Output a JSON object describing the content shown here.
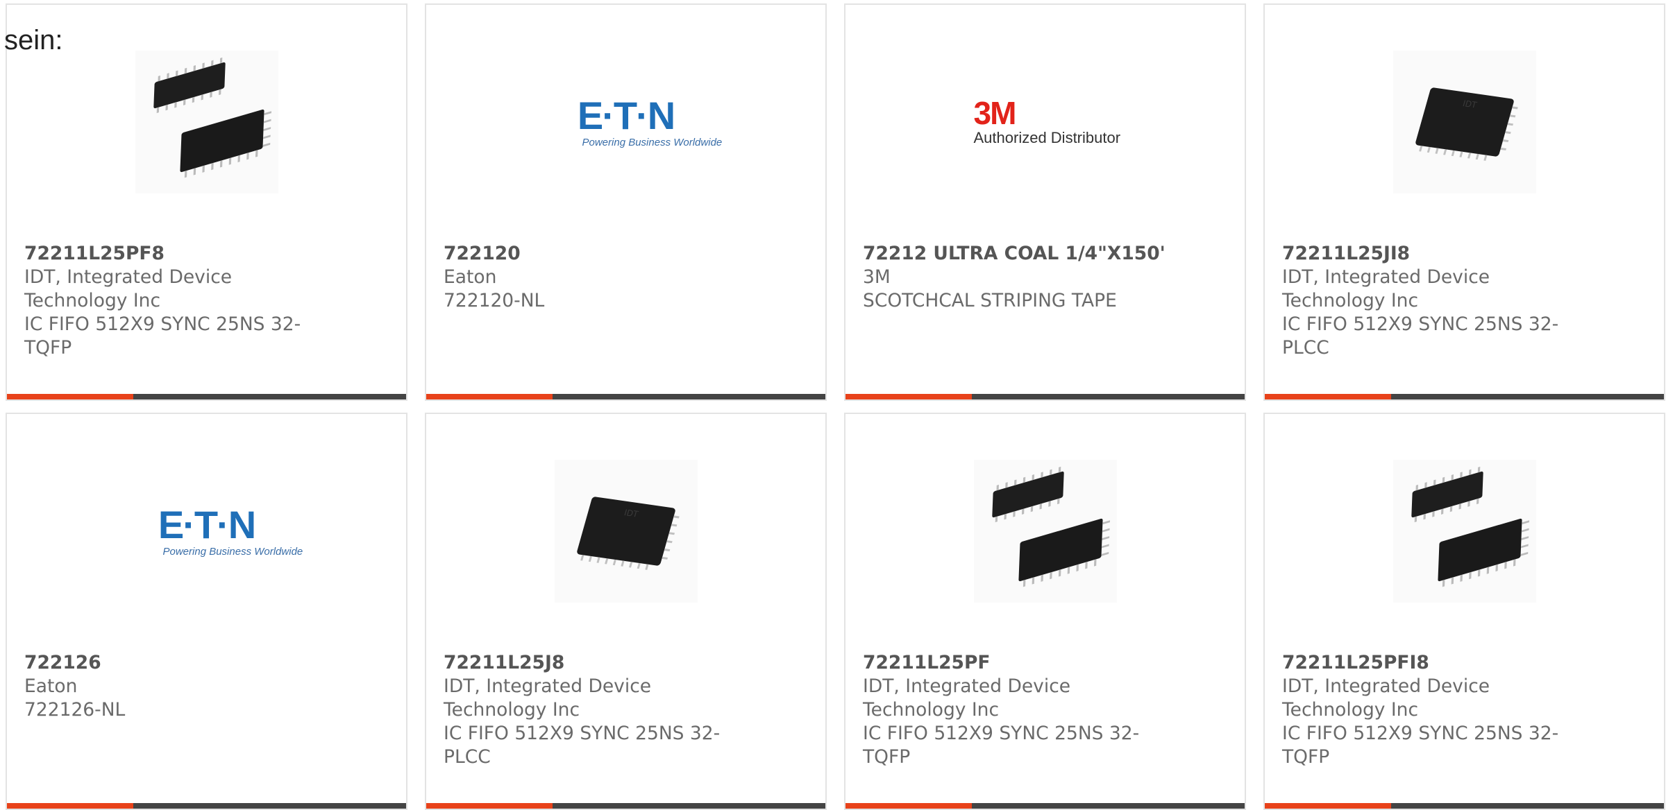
{
  "intro_text": "sein:",
  "theme": {
    "accent": "#e8421a",
    "bar": "#444444",
    "border": "#e3e3e3"
  },
  "cards": [
    {
      "part_number": "72211L25PF8",
      "manufacturer": "IDT, Integrated Device Technology Inc",
      "description": "IC FIFO 512X9 SYNC 25NS 32-TQFP",
      "image": "tqfp-chip-pair"
    },
    {
      "part_number": "722120",
      "manufacturer": "Eaton",
      "description": "722120-NL",
      "image": "eaton-logo",
      "logo": {
        "word": "E·T·N",
        "tagline": "Powering Business Worldwide"
      }
    },
    {
      "part_number": "72212 ULTRA COAL 1/4\"X150'",
      "manufacturer": "3M",
      "description": "SCOTCHCAL STRIPING TAPE",
      "image": "3m-logo",
      "logo": {
        "word": "3M",
        "tagline": "Authorized Distributor"
      }
    },
    {
      "part_number": "72211L25JI8",
      "manufacturer": "IDT, Integrated Device Technology Inc",
      "description": "IC FIFO 512X9 SYNC 25NS 32-PLCC",
      "image": "plcc-chip"
    },
    {
      "part_number": "722126",
      "manufacturer": "Eaton",
      "description": "722126-NL",
      "image": "eaton-logo",
      "logo": {
        "word": "E·T·N",
        "tagline": "Powering Business Worldwide"
      }
    },
    {
      "part_number": "72211L25J8",
      "manufacturer": "IDT, Integrated Device Technology Inc",
      "description": "IC FIFO 512X9 SYNC 25NS 32-PLCC",
      "image": "plcc-chip"
    },
    {
      "part_number": "72211L25PF",
      "manufacturer": "IDT, Integrated Device Technology Inc",
      "description": "IC FIFO 512X9 SYNC 25NS 32-TQFP",
      "image": "tqfp-chip-pair"
    },
    {
      "part_number": "72211L25PFI8",
      "manufacturer": "IDT, Integrated Device Technology Inc",
      "description": "IC FIFO 512X9 SYNC 25NS 32-TQFP",
      "image": "tqfp-chip-pair"
    }
  ]
}
